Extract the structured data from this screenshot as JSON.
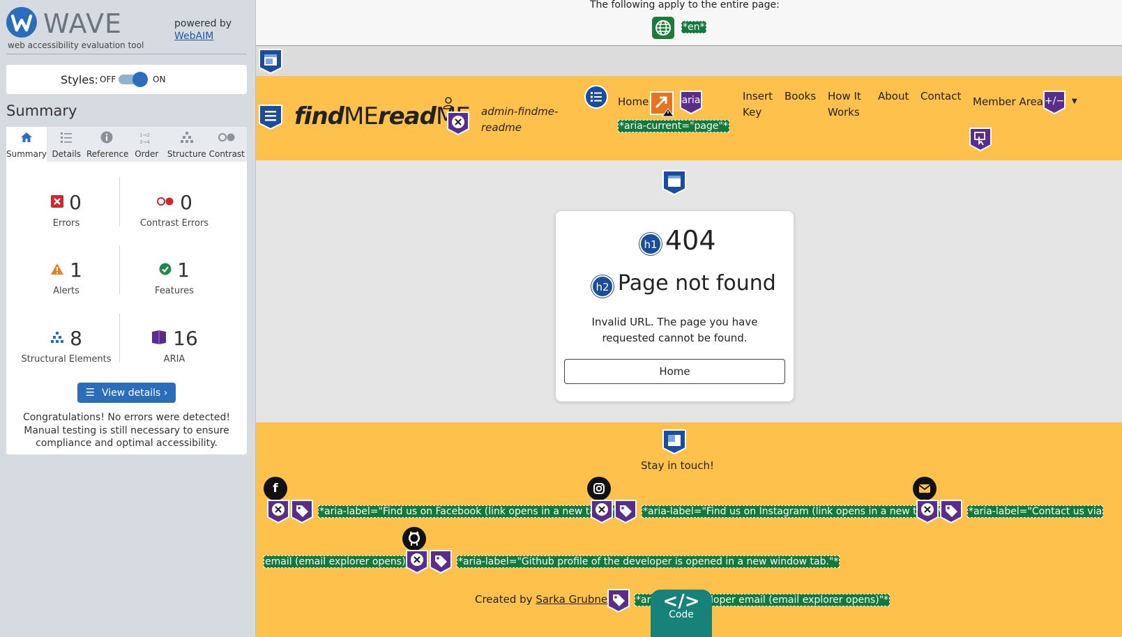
{
  "wave": {
    "title": "WAVE",
    "tagline": "web accessibility evaluation tool",
    "powered_by": "powered by",
    "webaim_link": "WebAIM",
    "styles_label": "Styles:",
    "styles_off": "OFF",
    "styles_on": "ON",
    "summary_heading": "Summary",
    "tabs": [
      {
        "label": "Summary",
        "icon": "home-icon"
      },
      {
        "label": "Details",
        "icon": "list-icon"
      },
      {
        "label": "Reference",
        "icon": "info-icon"
      },
      {
        "label": "Order",
        "icon": "order-icon"
      },
      {
        "label": "Structure",
        "icon": "structure-icon"
      },
      {
        "label": "Contrast",
        "icon": "contrast-icon"
      }
    ],
    "stats": {
      "errors": {
        "value": "0",
        "label": "Errors"
      },
      "contrast_errors": {
        "value": "0",
        "label": "Contrast Errors"
      },
      "alerts": {
        "value": "1",
        "label": "Alerts"
      },
      "features": {
        "value": "1",
        "label": "Features"
      },
      "structural": {
        "value": "8",
        "label": "Structural Elements"
      },
      "aria": {
        "value": "16",
        "label": "ARIA"
      }
    },
    "view_details": "View details ›",
    "congrats": "Congratulations! No errors were detected! Manual testing is still necessary to ensure compliance and optimal accessibility."
  },
  "colors": {
    "wave_blue": "#2a6ebb",
    "header_yellow": "#fdc14c",
    "aria_purple": "#5b2d8a",
    "highlight_green": "#137a3d",
    "structure_navy": "#1a4e9c"
  },
  "page": {
    "apply_text": "The following apply to the entire page:",
    "lang_tag": "*en*",
    "brand_find": "find",
    "brand_me1": "ME",
    "brand_read": "read",
    "brand_me2": "ME",
    "username_line1": "admin-findme-",
    "username_line2": "readme",
    "nav": {
      "home": "Home",
      "insert_key_1": "Insert",
      "insert_key_2": "Key",
      "books": "Books",
      "how_1": "How It",
      "how_2": "Works",
      "about": "About",
      "contact": "Contact",
      "member": "Member Area"
    },
    "aria_current": "*aria-current=\"page\"*",
    "aria_badge": "aria",
    "aria_expand_badge": "+/−",
    "h1_badge": "h1",
    "h2_badge": "h2",
    "error_code": "404",
    "error_title": "Page not found",
    "error_message": "Invalid URL. The page you have requested cannot be found.",
    "home_button": "Home",
    "stay_in_touch": "Stay in touch!",
    "aria_facebook": "*aria-label=\"Find us on Facebook (link opens in a new tab)\"*",
    "aria_instagram": "*aria-label=\"Find us on Instagram (link opens in a new tab)\"*",
    "aria_contact_a": "*aria-label=\"Contact us via",
    "aria_contact_b": "email (email explorer opens)\"*",
    "aria_github": "*aria-label=\"Github profile of the developer is opened in a new window tab.\"*",
    "created_by": "Created by",
    "author": "Sarka Grubner",
    "aria_dev_a": "*ari",
    "aria_dev_b": "loper email (email explorer opens)\"*",
    "code_label": "Code",
    "code_glyph": "</>"
  }
}
